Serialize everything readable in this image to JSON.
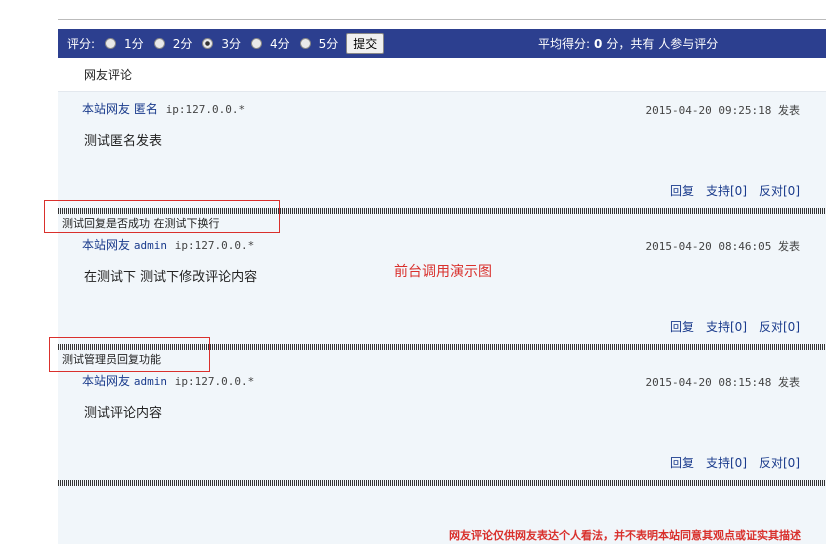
{
  "rating": {
    "label": "评分:",
    "options": [
      {
        "label": "1分",
        "checked": false
      },
      {
        "label": "2分",
        "checked": false
      },
      {
        "label": "3分",
        "checked": true
      },
      {
        "label": "4分",
        "checked": false
      },
      {
        "label": "5分",
        "checked": false
      }
    ],
    "submit_label": "提交",
    "avg_prefix": "平均得分:",
    "avg_value": "0",
    "avg_suffix": "分，共有 人参与评分"
  },
  "section_title": "网友评论",
  "comments": [
    {
      "site": "本站网友",
      "user": "匿名",
      "ip": "ip:127.0.0.*",
      "time": "2015-04-20 09:25:18 发表",
      "content": "测试匿名发表"
    },
    {
      "site": "本站网友",
      "user": "admin",
      "ip": "ip:127.0.0.*",
      "time": "2015-04-20 08:46:05 发表",
      "content": "在测试下 测试下修改评论内容"
    },
    {
      "site": "本站网友",
      "user": "admin",
      "ip": "ip:127.0.0.*",
      "time": "2015-04-20 08:15:48 发表",
      "content": "测试评论内容"
    }
  ],
  "actions": {
    "reply": "回复",
    "support": "支持[0]",
    "oppose": "反对[0]"
  },
  "replies": [
    "测试回复是否成功 在测试下换行",
    "测试管理员回复功能"
  ],
  "demo_label": "前台调用演示图",
  "disclaimer": "网友评论仅供网友表达个人看法，并不表明本站同意其观点或证实其描述",
  "colors": {
    "bar": "#2c3f8f",
    "link": "#1a3b8c",
    "annotation": "#d9302c"
  }
}
